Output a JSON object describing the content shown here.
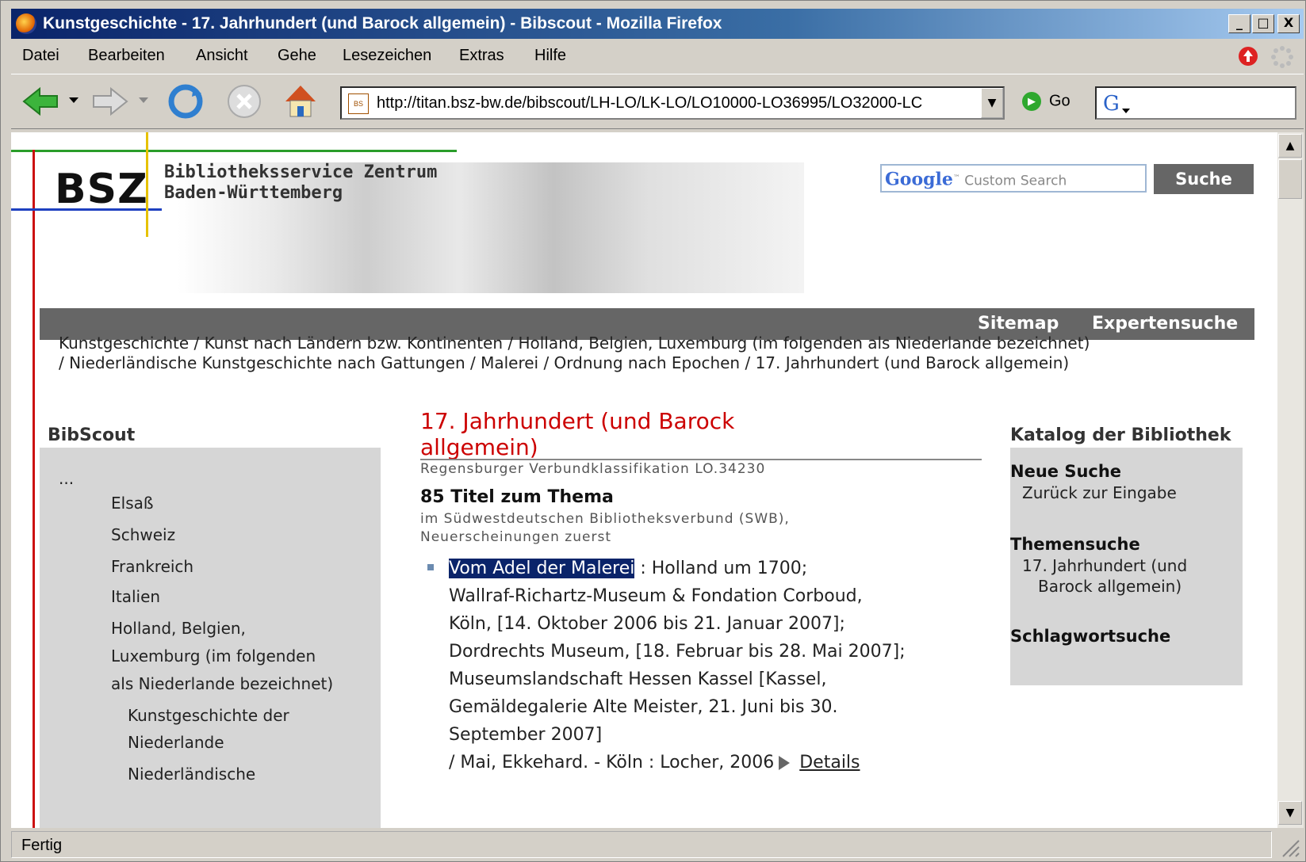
{
  "window": {
    "title": "Kunstgeschichte - 17. Jahrhundert (und Barock allgemein) - Bibscout - Mozilla Firefox",
    "min": "_",
    "max": "□",
    "close": "X"
  },
  "menu": [
    "Datei",
    "Bearbeiten",
    "Ansicht",
    "Gehe",
    "Lesezeichen",
    "Extras",
    "Hilfe"
  ],
  "toolbar": {
    "url": "http://titan.bsz-bw.de/bibscout/LH-LO/LK-LO/LO10000-LO36995/LO32000-LC",
    "site_icon_text": "BS",
    "go_label": "Go"
  },
  "status": "Fertig",
  "page": {
    "logo": "BSZ",
    "org_line1": "Bibliotheksservice Zentrum",
    "org_line2": "Baden-Württemberg",
    "search_placeholder": "Custom Search",
    "search_brand": "Google",
    "search_button": "Suche",
    "nav": [
      "Sitemap",
      "Expertensuche"
    ],
    "breadcrumb_line1": "Kunstgeschichte / Kunst nach Ländern bzw. Kontinenten / Holland, Belgien, Luxemburg (im folgenden als Niederlande bezeichnet)",
    "breadcrumb_line2": "/ Niederländische Kunstgeschichte nach Gattungen / Malerei / Ordnung nach Epochen / 17. Jahrhundert (und Barock allgemein)",
    "left": {
      "title": "BibScout",
      "items": [
        "...",
        "Elsaß",
        "Schweiz",
        "Frankreich",
        "Italien",
        "Holland, Belgien,",
        "Luxemburg (im folgenden",
        "als Niederlande bezeichnet)",
        "Kunstgeschichte der",
        "Niederlande",
        "Niederländische"
      ]
    },
    "main": {
      "heading_line1": "17. Jahrhundert (und Barock",
      "heading_line2": "allgemein)",
      "classification": "Regensburger Verbundklassifikation  LO.34230",
      "count_title": "85 Titel zum Thema",
      "count_sub1": "im Südwestdeutschen Bibliotheksverbund (SWB),",
      "count_sub2": "Neuerscheinungen zuerst",
      "record": {
        "title_highlight": "Vom Adel der Malerei",
        "line1_rest": " : Holland um 1700;",
        "line2": "Wallraf-Richartz-Museum & Fondation Corboud,",
        "line3": "Köln, [14. Oktober 2006 bis 21. Januar 2007];",
        "line4": "Dordrechts Museum, [18. Februar bis 28. Mai 2007];",
        "line5": "Museumslandschaft Hessen Kassel [Kassel,",
        "line6": "Gemäldegalerie Alte Meister, 21. Juni bis 30.",
        "line7": "September 2007]",
        "line8": "/ Mai, Ekkehard. - Köln : Locher, 2006",
        "details": "Details"
      }
    },
    "right": {
      "title": "Katalog der Bibliothek",
      "neue_suche": "Neue Suche",
      "zurueck": "Zurück zur Eingabe",
      "themensuche": "Themensuche",
      "thema1": "17. Jahrhundert (und",
      "thema2": "Barock allgemein)",
      "schlagwortsuche": "Schlagwortsuche"
    }
  }
}
